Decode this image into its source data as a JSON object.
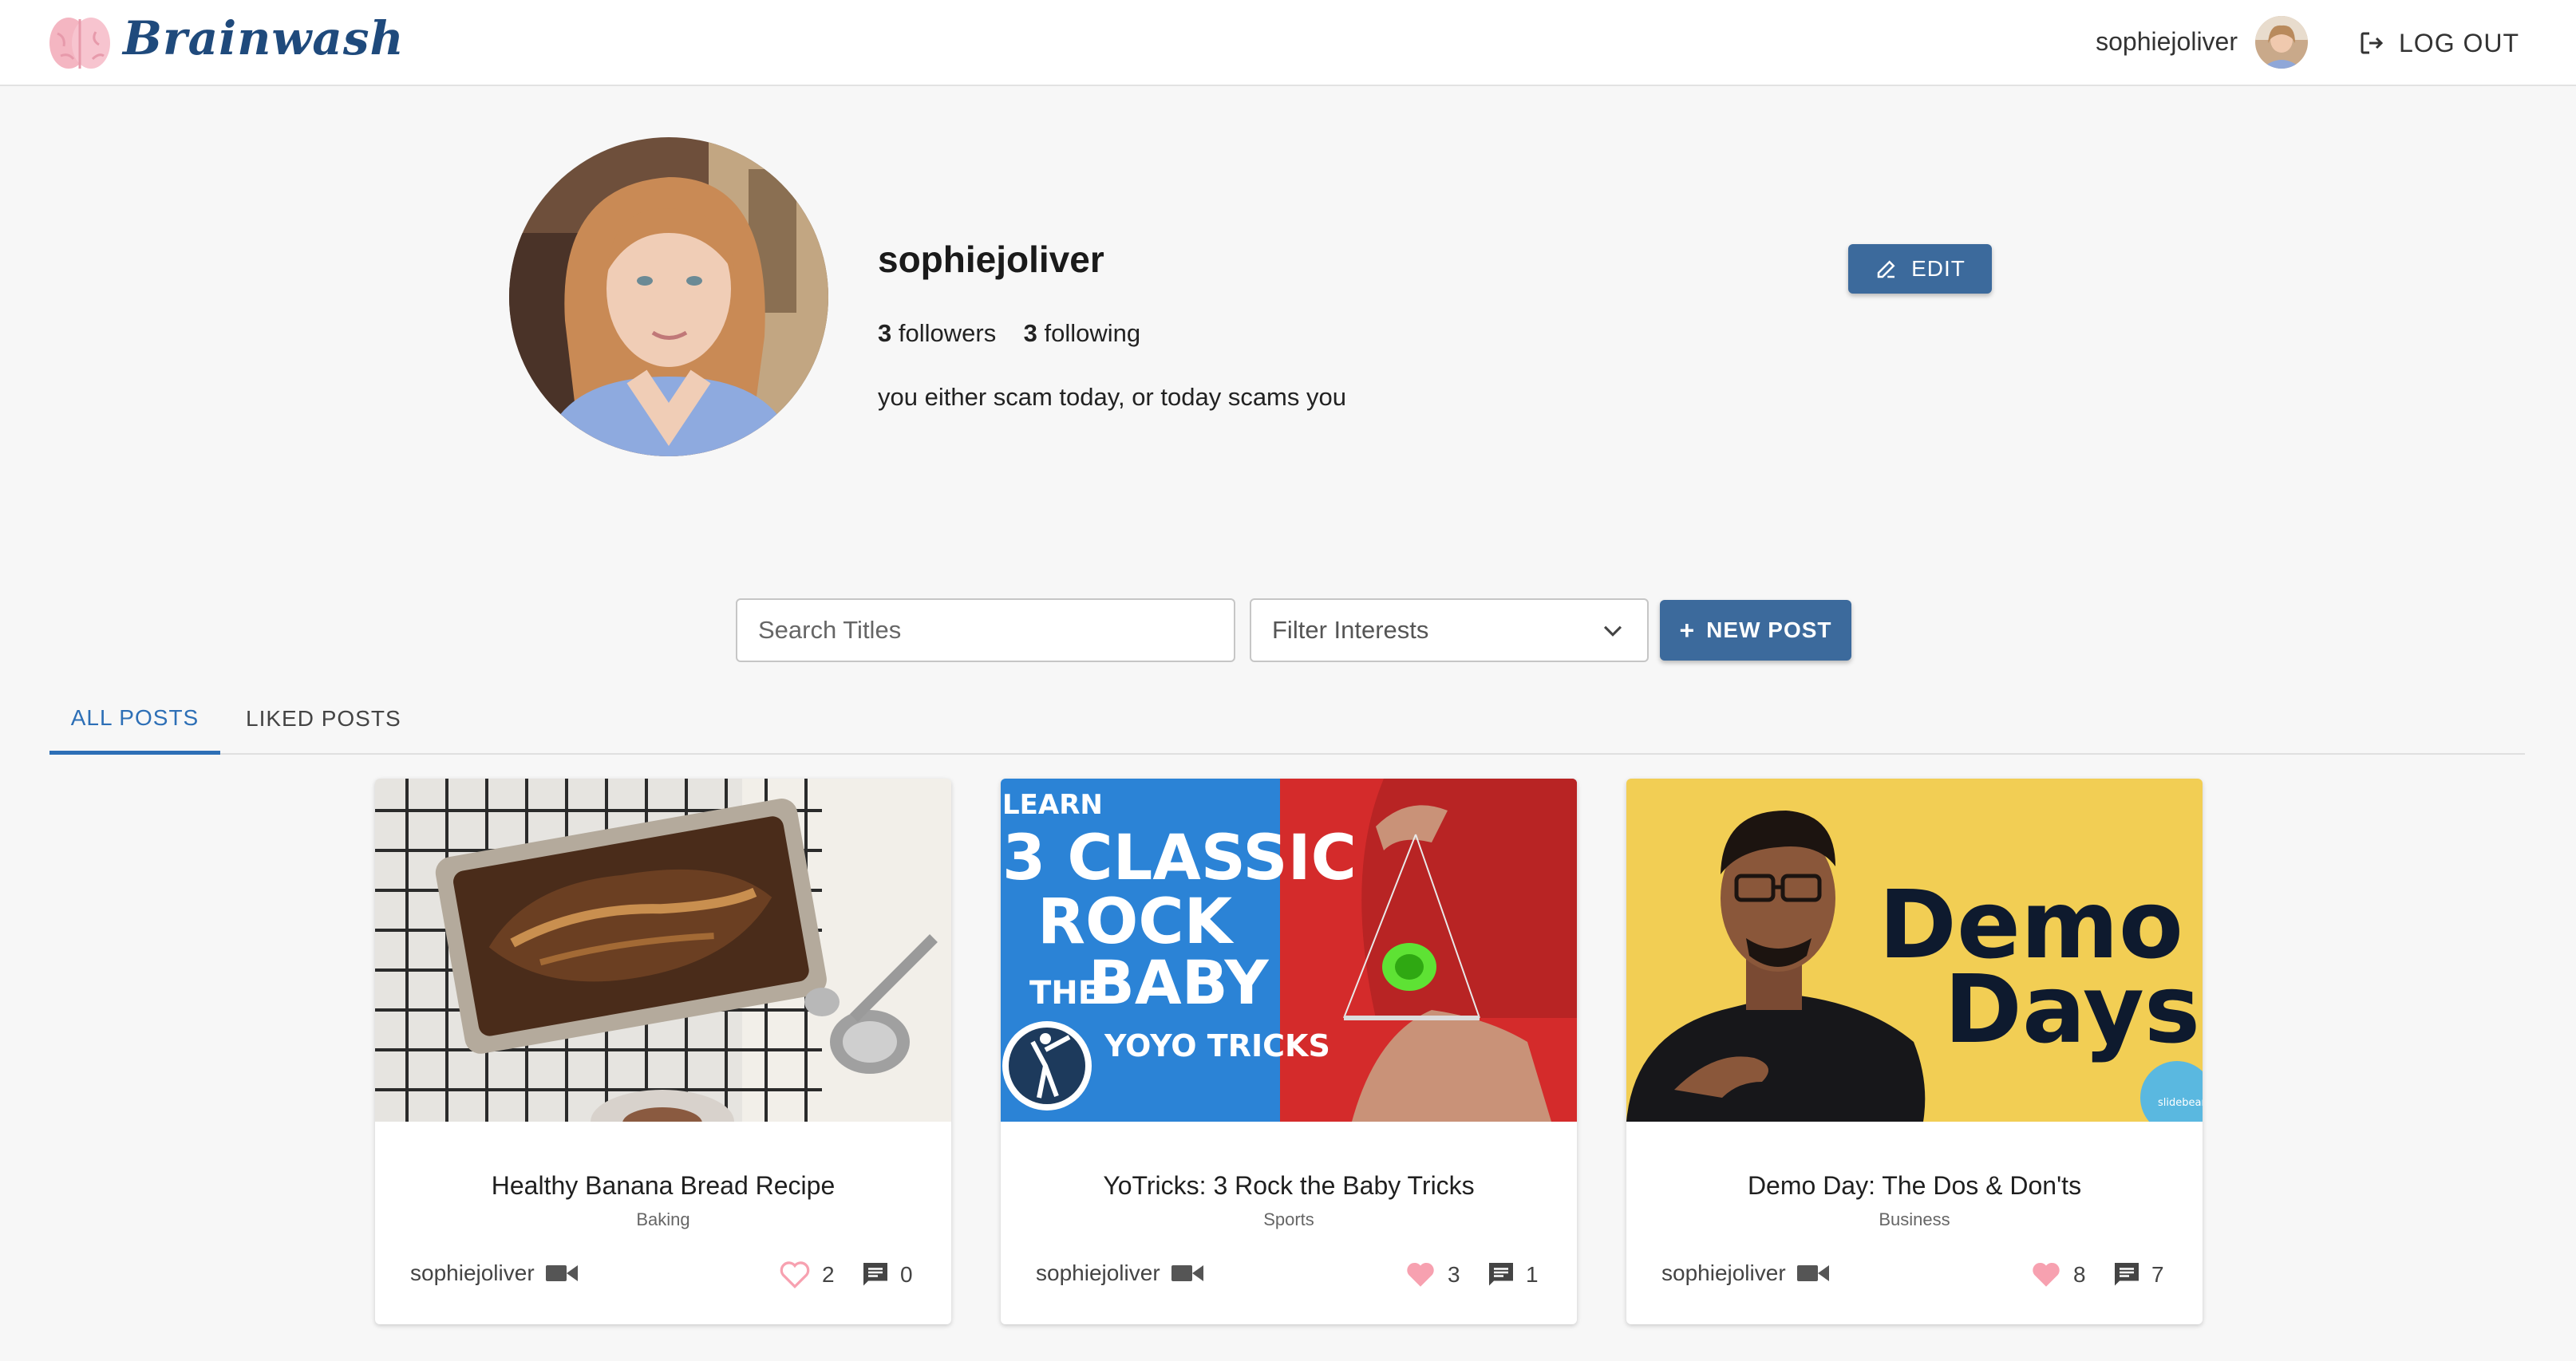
{
  "brand": {
    "name": "Brainwash"
  },
  "header": {
    "username": "sophiejoliver",
    "logout_label": "LOG OUT"
  },
  "profile": {
    "username": "sophiejoliver",
    "followers_count": "3",
    "followers_label": "followers",
    "following_count": "3",
    "following_label": "following",
    "bio": "you either scam today, or today scams you",
    "edit_label": "EDIT"
  },
  "controls": {
    "search_placeholder": "Search Titles",
    "filter_placeholder": "Filter Interests",
    "new_post_label": "NEW POST"
  },
  "tabs": [
    {
      "label": "ALL POSTS",
      "active": true
    },
    {
      "label": "LIKED POSTS",
      "active": false
    }
  ],
  "posts": [
    {
      "title": "Healthy Banana Bread Recipe",
      "category": "Baking",
      "author": "sophiejoliver",
      "likes": "2",
      "comments": "0",
      "liked": false,
      "thumbnail_text": []
    },
    {
      "title": "YoTricks: 3 Rock the Baby Tricks",
      "category": "Sports",
      "author": "sophiejoliver",
      "likes": "3",
      "comments": "1",
      "liked": true,
      "thumbnail_text": [
        "LEARN",
        "3 CLASSIC",
        "ROCK",
        "THE",
        "BABY",
        "YOYO TRICKS"
      ]
    },
    {
      "title": "Demo Day: The Dos & Don'ts",
      "category": "Business",
      "author": "sophiejoliver",
      "likes": "8",
      "comments": "7",
      "liked": true,
      "thumbnail_text": [
        "Demo",
        "Days",
        "slidebean"
      ]
    }
  ],
  "colors": {
    "accent": "#3c6a9c",
    "tab_active": "#2d6fb6",
    "heart": "#f7a1b0",
    "brand": "#1f4a7c"
  }
}
